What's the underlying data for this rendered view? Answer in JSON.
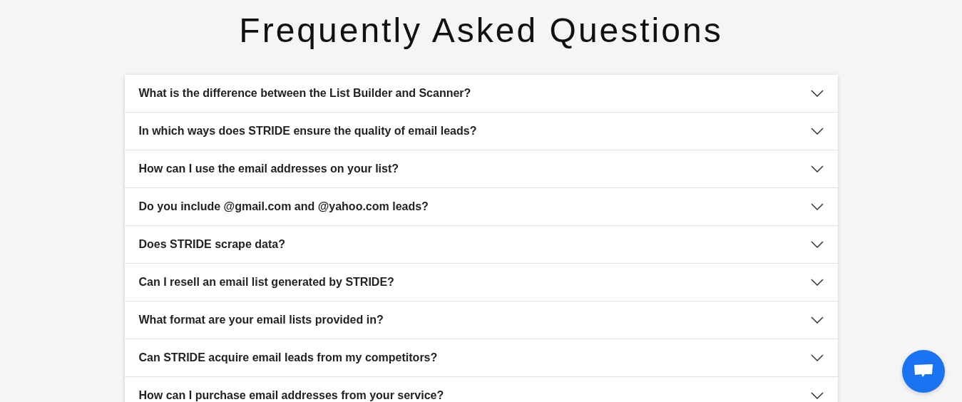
{
  "title": "Frequently Asked Questions",
  "faq": [
    {
      "question": "What is the difference between the List Builder and Scanner?",
      "expanded": false
    },
    {
      "question": "In which ways does STRIDE ensure the quality of email leads?",
      "expanded": false
    },
    {
      "question": "How can I use the email addresses on your list?",
      "expanded": false
    },
    {
      "question": "Do you include @gmail.com and @yahoo.com leads?",
      "expanded": false
    },
    {
      "question": "Does STRIDE scrape data?",
      "expanded": false
    },
    {
      "question": "Can I resell an email list generated by STRIDE?",
      "expanded": false
    },
    {
      "question": "What format are your email lists provided in?",
      "expanded": false
    },
    {
      "question": "Can STRIDE acquire email leads from my competitors?",
      "expanded": false
    },
    {
      "question": "How can I purchase email addresses from your service?",
      "expanded": false
    }
  ]
}
